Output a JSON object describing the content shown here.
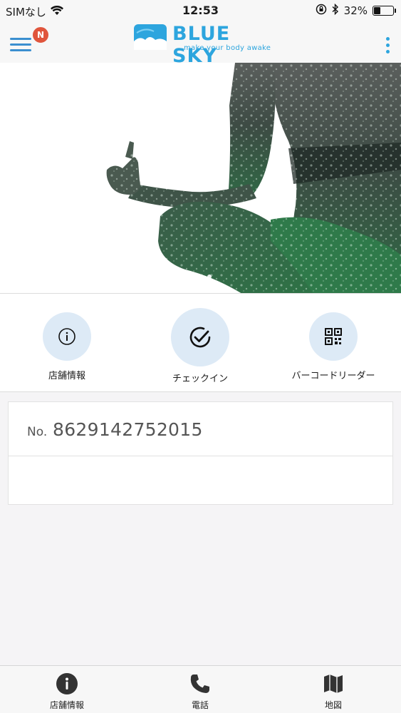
{
  "status_bar": {
    "carrier": "SIMなし",
    "time": "12:53",
    "battery_percent": "32%",
    "battery_level": 0.32
  },
  "header": {
    "notification_badge": "N",
    "logo_title": "BLUE SKY",
    "logo_tagline": "make your body awake",
    "accent_color": "#2da5de",
    "badge_color": "#e0553c"
  },
  "actions": [
    {
      "label": "店舗情報",
      "icon": "info-icon"
    },
    {
      "label": "チェックイン",
      "icon": "checkmark-icon"
    },
    {
      "label": "バーコードリーダー",
      "icon": "qr-code-icon"
    }
  ],
  "member_card": {
    "prefix": "No.",
    "number": "8629142752015"
  },
  "tab_bar": [
    {
      "label": "店舗情報",
      "icon": "info-icon"
    },
    {
      "label": "電話",
      "icon": "phone-icon"
    },
    {
      "label": "地図",
      "icon": "map-icon"
    }
  ]
}
